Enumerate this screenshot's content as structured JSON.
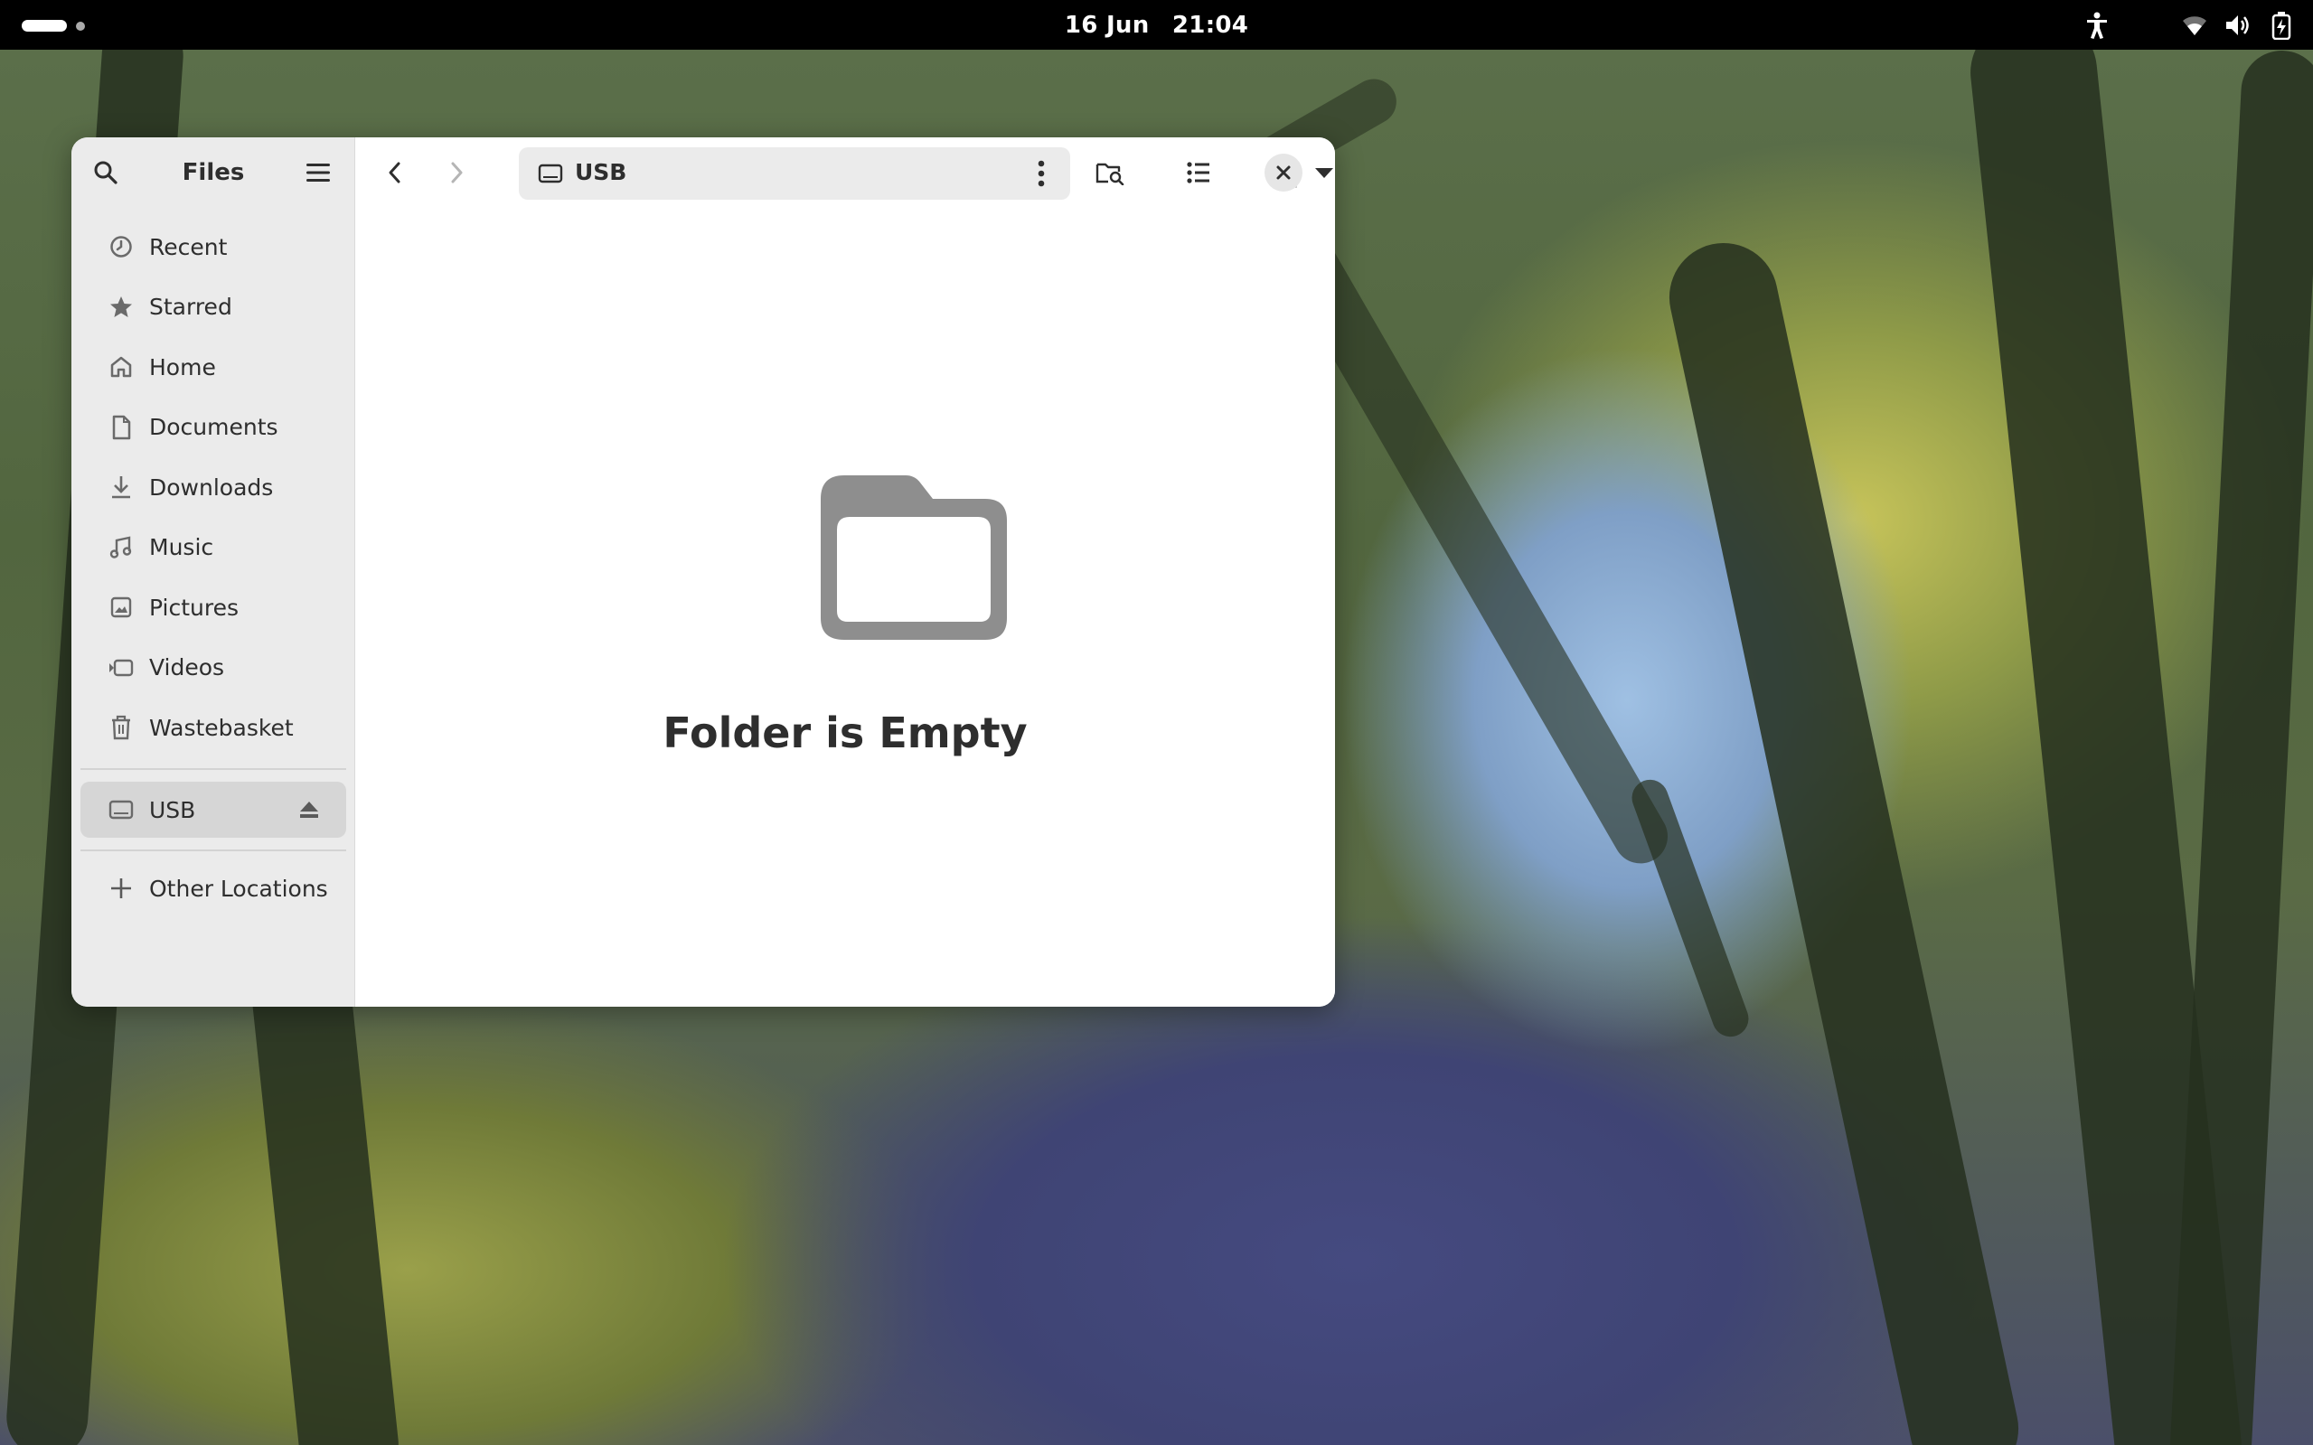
{
  "topbar": {
    "date": "16 Jun",
    "time": "21:04",
    "icons": [
      "accessibility-icon",
      "wifi-icon",
      "volume-icon",
      "battery-icon"
    ]
  },
  "window": {
    "sidebar_title": "Files",
    "places": [
      {
        "label": "Recent",
        "icon": "clock-icon"
      },
      {
        "label": "Starred",
        "icon": "star-icon"
      },
      {
        "label": "Home",
        "icon": "home-icon"
      },
      {
        "label": "Documents",
        "icon": "document-icon"
      },
      {
        "label": "Downloads",
        "icon": "download-icon"
      },
      {
        "label": "Music",
        "icon": "music-icon"
      },
      {
        "label": "Pictures",
        "icon": "picture-icon"
      },
      {
        "label": "Videos",
        "icon": "video-icon"
      },
      {
        "label": "Wastebasket",
        "icon": "trash-icon"
      }
    ],
    "devices": [
      {
        "label": "USB",
        "icon": "drive-icon",
        "selected": true
      }
    ],
    "other_locations": "Other Locations",
    "path": {
      "current": "USB"
    },
    "empty_state": {
      "title": "Folder is Empty"
    }
  },
  "colors": {
    "accent": "#2e2e2e",
    "sidebar_bg": "#ebebeb",
    "selected_bg": "#d6d6d6",
    "icon_gray": "#8e8e8e"
  }
}
